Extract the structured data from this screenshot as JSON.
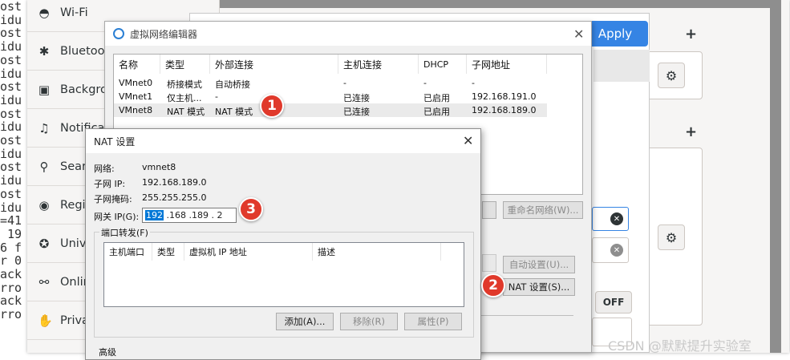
{
  "terminal": {
    "lines": [
      "ost",
      "idu",
      "ost",
      "idu",
      "ost",
      "idu",
      "ost",
      "idu",
      "ost",
      "idu",
      "ost",
      "idu",
      "ost",
      "idu",
      "ost",
      "idu",
      "=41",
      " 19",
      "6 f",
      "r 0",
      "ack",
      "rro",
      "ack",
      "rro"
    ]
  },
  "settings": {
    "apply_label": "Apply",
    "off_label": "OFF",
    "sidebar": [
      {
        "label": "Wi-Fi",
        "icon": "wifi-icon",
        "glyph": "◓"
      },
      {
        "label": "Bluetoot",
        "icon": "bluetooth-icon",
        "glyph": "✱"
      },
      {
        "label": "Backgrou",
        "icon": "background-icon",
        "glyph": "▣"
      },
      {
        "label": "Notificati",
        "icon": "bell-icon",
        "glyph": "♫"
      },
      {
        "label": "Search",
        "icon": "search-icon",
        "glyph": "⚲"
      },
      {
        "label": "Regio",
        "icon": "camera-icon",
        "glyph": "◉"
      },
      {
        "label": "Unive",
        "icon": "accessibility-icon",
        "glyph": "✪"
      },
      {
        "label": "Onlin",
        "icon": "online-accounts-icon",
        "glyph": "⚯"
      },
      {
        "label": "Privac",
        "icon": "hand-icon",
        "glyph": "✋"
      }
    ]
  },
  "vne": {
    "title": "虚拟网络编辑器",
    "columns": [
      "名称",
      "类型",
      "外部连接",
      "主机连接",
      "DHCP",
      "子网地址"
    ],
    "rows": [
      {
        "name": "VMnet0",
        "type": "桥接模式",
        "ext": "自动桥接",
        "host": "-",
        "dhcp": "-",
        "subnet": "-"
      },
      {
        "name": "VMnet1",
        "type": "仅主机...",
        "ext": "-",
        "host": "已连接",
        "dhcp": "已启用",
        "subnet": "192.168.191.0"
      },
      {
        "name": "VMnet8",
        "type": "NAT 模式",
        "ext": "NAT 模式",
        "host": "已连接",
        "dhcp": "已启用",
        "subnet": "192.168.189.0"
      }
    ],
    "rename_btn": "重命名网络(W)...",
    "auto_btn": "自动设置(U)...",
    "nat_btn": "NAT 设置(S)..."
  },
  "nat": {
    "title": "NAT 设置",
    "network_label": "网络:",
    "network_value": "vmnet8",
    "subnet_ip_label": "子网 IP:",
    "subnet_ip_value": "192.168.189.0",
    "mask_label": "子网掩码:",
    "mask_value": "255.255.255.0",
    "gateway_label": "网关 IP(G):",
    "gateway_selected": "192",
    "gateway_rest": " .168 .189 . 2",
    "pf_label": "端口转发(F)",
    "pf_columns": [
      "主机端口",
      "类型",
      "虚拟机 IP 地址",
      "描述"
    ],
    "add_btn": "添加(A)...",
    "remove_btn": "移除(R)",
    "props_btn": "属性(P)",
    "advanced_label": "高级"
  },
  "badges": [
    "1",
    "2",
    "3"
  ],
  "watermark": "CSDN @默默提升实验室",
  "colors": {
    "accent": "#3584e4",
    "badge": "#e0392b",
    "selection": "#0078d7"
  }
}
